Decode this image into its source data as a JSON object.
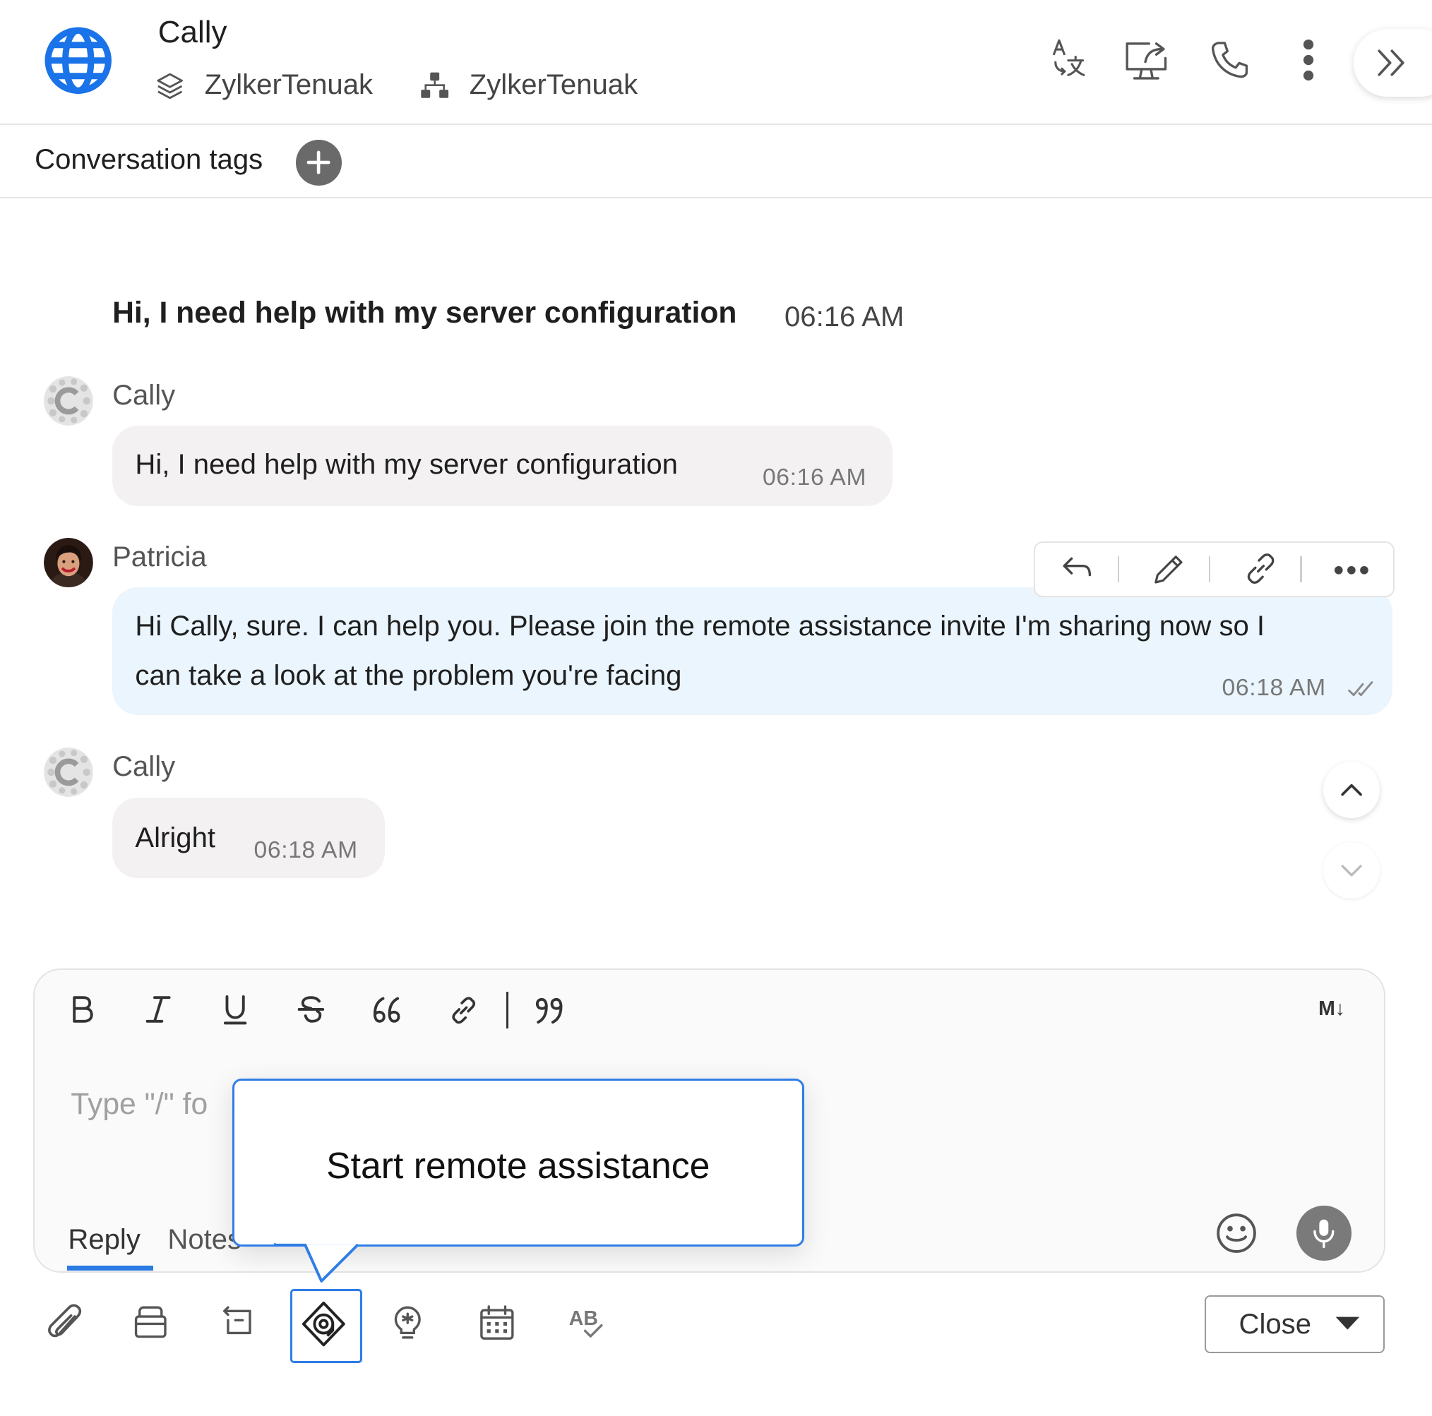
{
  "header": {
    "contact_name": "Cally",
    "department": "ZylkerTenuak",
    "organization": "ZylkerTenuak",
    "icons": [
      "globe-icon",
      "translate-icon",
      "screen-share-icon",
      "phone-icon",
      "more-vertical-icon",
      "expand-icon"
    ]
  },
  "tags": {
    "label": "Conversation tags"
  },
  "messages": {
    "preview": {
      "text": "Hi, I need help with my server configuration",
      "time": "06:16 AM"
    },
    "items": [
      {
        "sender": "Cally",
        "text": "Hi, I need help with my server configuration",
        "time": "06:16 AM"
      },
      {
        "sender": "Patricia",
        "line1": "Hi Cally, sure. I can help you. Please join the remote assistance invite I'm sharing now so I",
        "line2": "can take a look at the problem you're facing",
        "time": "06:18 AM"
      },
      {
        "sender": "Cally",
        "text": "Alright",
        "time": "06:18 AM"
      }
    ],
    "actions": [
      "reply-icon",
      "edit-icon",
      "link-icon",
      "more-horizontal-icon"
    ]
  },
  "editor": {
    "format_tools": [
      "B",
      "I",
      "U",
      "S",
      "66",
      "link",
      "99"
    ],
    "markdown_label": "M↓",
    "placeholder": "Type \"/\" fo",
    "tabs": {
      "reply": "Reply",
      "notes": "Notes"
    }
  },
  "tooltip": {
    "text": "Start remote assistance"
  },
  "toolbar": {
    "tools": [
      "attachment-icon",
      "knowledge-base-icon",
      "canned-response-icon",
      "remote-assistance-icon",
      "idea-icon",
      "calendar-icon",
      "spell-check-icon"
    ],
    "spell_check_label": "AB",
    "close_label": "Close"
  },
  "colors": {
    "accent": "#2f7de6",
    "agent_bubble": "#eaf5fd",
    "visitor_bubble": "#f3f1f1"
  }
}
